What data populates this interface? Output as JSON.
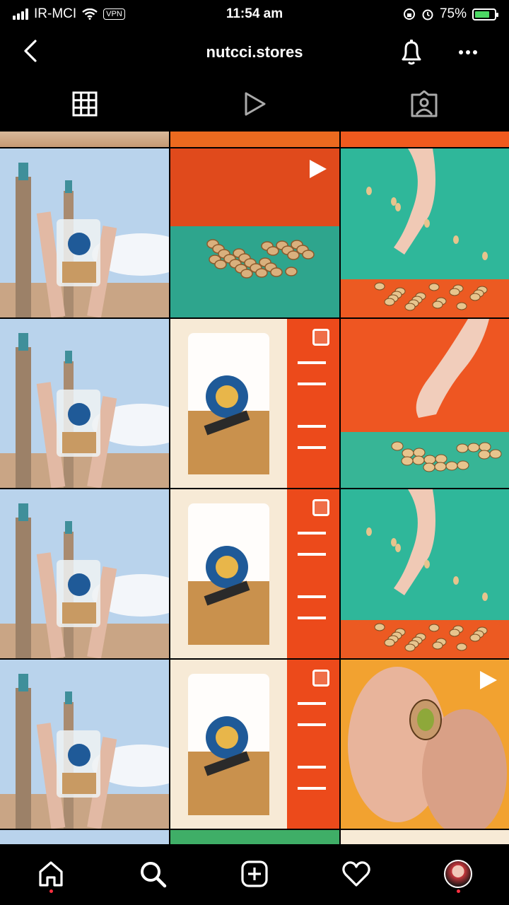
{
  "status_bar": {
    "carrier": "IR-MCI",
    "vpn": "VPN",
    "time": "11:54 am",
    "battery": "75%",
    "battery_level": 0.75
  },
  "header": {
    "title": "nutcci.stores"
  },
  "tabs": [
    {
      "icon": "grid-icon"
    },
    {
      "icon": "reels-play-icon"
    },
    {
      "icon": "tagged-person-icon"
    }
  ],
  "posts": [
    {
      "type": "mosque-hand",
      "badge": "none"
    },
    {
      "type": "orange-green-pile",
      "badge": "video"
    },
    {
      "type": "teal-hand-drop",
      "badge": "none"
    },
    {
      "type": "mosque-hand",
      "badge": "none"
    },
    {
      "type": "bag-price",
      "badge": "multi"
    },
    {
      "type": "orange-hand-salt",
      "badge": "none"
    },
    {
      "type": "mosque-hand",
      "badge": "none"
    },
    {
      "type": "bag-price",
      "badge": "multi"
    },
    {
      "type": "teal-hand-drop",
      "badge": "none"
    },
    {
      "type": "mosque-hand",
      "badge": "none"
    },
    {
      "type": "bag-price",
      "badge": "multi"
    },
    {
      "type": "fingers-nut",
      "badge": "video"
    }
  ],
  "bottom_nav": [
    {
      "icon": "home-icon",
      "dot": true
    },
    {
      "icon": "search-icon",
      "dot": false
    },
    {
      "icon": "create-icon",
      "dot": false
    },
    {
      "icon": "heart-icon",
      "dot": false
    },
    {
      "icon": "profile-avatar",
      "dot": true
    }
  ],
  "colors": {
    "sky": "#b9d3ec",
    "orange": "#e8542a",
    "teal": "#2fb79a",
    "cream": "#f7ead6"
  }
}
